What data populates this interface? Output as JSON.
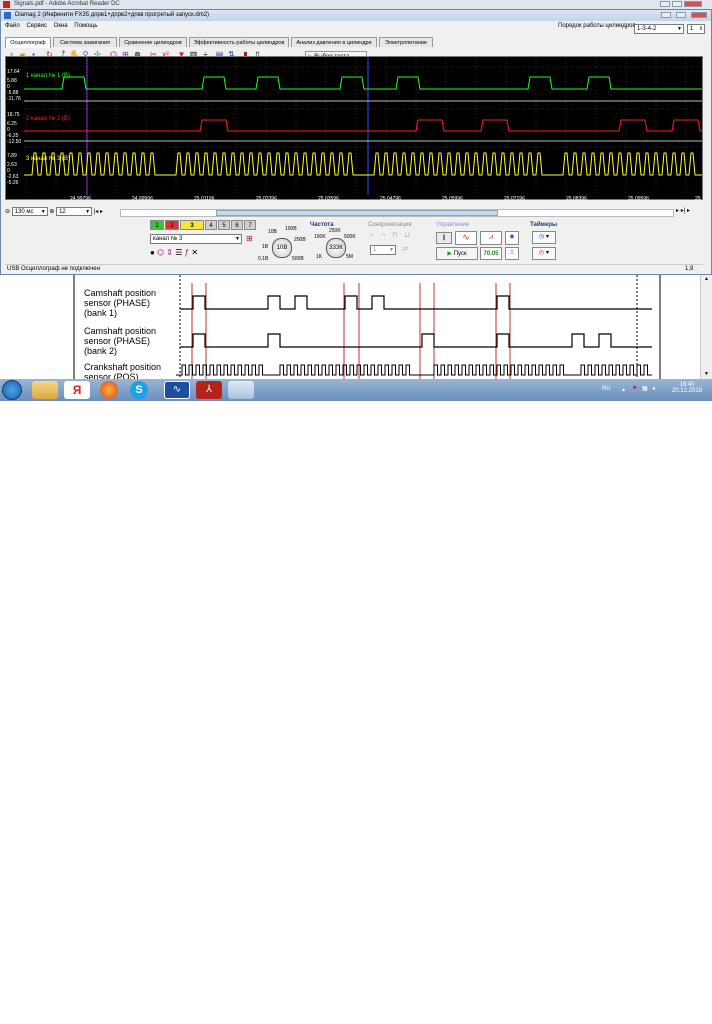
{
  "acrobat": {
    "title": "Signals.pdf - Adobe Acrobat Reader DC"
  },
  "diamag": {
    "title": "Diamag 2 (Инфинити  FX35 дпрв1+дпрв2+дпкв прогретый  запуск.dm2)",
    "menu": [
      "Файл",
      "Сервис",
      "Окна",
      "Помощь"
    ],
    "order_label": "Порядок работы цилиндров",
    "order_value": "1-3-4-2",
    "order_spin": "1",
    "tabs": [
      "Осциллограф",
      "Система зажигания",
      "Сравнение цилиндров",
      "Эффективность работы цилиндров",
      "Анализ давления в цилиндре",
      "Электропитание"
    ],
    "test_select": "Выбор теста",
    "channels": [
      {
        "label": "1  канал № 1 (В)",
        "color": "#22ff22",
        "scale": [
          "17.64",
          "5.88",
          "0",
          "-5.88",
          "-11.76"
        ]
      },
      {
        "label": "2  канал № 2 (В)",
        "color": "#ff2020",
        "scale": [
          "18.75",
          "6.25",
          "0",
          "-6.25",
          "-12.50"
        ]
      },
      {
        "label": "3  канал № 3 (В)",
        "color": "#ffff30",
        "scale": [
          "7.89",
          "2.63",
          "0",
          "-2.63",
          "-5.26"
        ]
      }
    ],
    "time_ticks": [
      "24.99796",
      "24.99996",
      "25.01196",
      "25.02396",
      "25.03596",
      "25.04796",
      "25.05996",
      "25.07196",
      "25.08396",
      "25.09596"
    ],
    "time_end": "25",
    "timebase": "130 мс",
    "zoom": "12",
    "channel_buttons": [
      "1",
      "2",
      "3",
      "4",
      "5",
      "6",
      "7"
    ],
    "channel_select": "канал № 3",
    "freq_label": "Частота",
    "sync_label": "Синхронизация",
    "sync_value": "1",
    "control_label": "Управление",
    "start_label": "Пуск",
    "fps_value": "70.05",
    "timers_label": "Таймеры",
    "volt_dial": [
      "10B",
      "100B",
      "1B",
      "200B",
      "0,1B",
      "500B"
    ],
    "volt_center": "10В",
    "freq_dial": [
      "250K",
      "100K",
      "500K",
      "1K",
      "5M"
    ],
    "freq_center": "333К",
    "status_text": "USB Осциллограф не подключен",
    "status_right": "1,9"
  },
  "document": {
    "rows": [
      {
        "label": "Camshaft position sensor (PHASE) (bank 1)",
        "lines": [
          "Camshaft position",
          "sensor (PHASE)",
          "(bank 1)"
        ]
      },
      {
        "label": "Camshaft position sensor (PHASE) (bank 2)",
        "lines": [
          "Camshaft position",
          "sensor (PHASE)",
          "(bank 2)"
        ]
      },
      {
        "label": "Crankshaft position sensor (POS)",
        "lines": [
          "Crankshaft position",
          "sensor (POS)"
        ]
      }
    ]
  },
  "taskbar": {
    "lang": "RU",
    "time": "18:40",
    "date": "20.12.2019",
    "apps": [
      "explorer-icon",
      "yandex-icon",
      "firefox-icon",
      "skype-icon",
      "diamag-icon",
      "acrobat-icon",
      "window-icon"
    ]
  }
}
